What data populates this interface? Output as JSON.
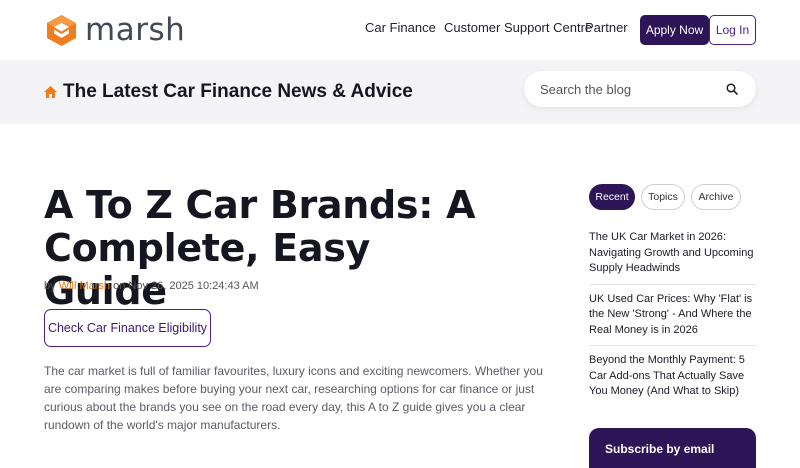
{
  "brand": {
    "name": "marsh",
    "accent": "#f07c1e",
    "primary": "#2d1558"
  },
  "nav": {
    "links": [
      "Car Finance",
      "Customer Support Centre",
      "Partner"
    ],
    "apply_label": "Apply Now",
    "login_label": "Log In"
  },
  "banner": {
    "title": "The Latest Car Finance News & Advice",
    "search_placeholder": "Search the blog",
    "home_icon": "home-icon",
    "search_icon": "search-icon"
  },
  "article": {
    "title": "A To Z Car Brands: A Complete, Easy Guide",
    "byline_prefix": "by",
    "author": "Will Marsh",
    "date_prefix": "on",
    "date": "Nov 26, 2025 10:24:43 AM",
    "cta_label": "Check Car Finance Eligibility",
    "intro": "The car market is full of familiar favourites, luxury icons and exciting newcomers. Whether you are comparing makes before buying your next car, researching options for car finance or just curious about the brands you see on the road every day, this A to Z guide gives you a clear rundown of the world's major manufacturers."
  },
  "sidebar": {
    "tabs": [
      "Recent",
      "Topics",
      "Archive"
    ],
    "active_tab": "Recent",
    "posts": [
      "The UK Car Market in 2026: Navigating Growth and Upcoming Supply Headwinds",
      "UK Used Car Prices: Why 'Flat' is the New 'Strong' - And Where the Real Money is in 2026",
      "Beyond the Monthly Payment: 5 Car Add-ons That Actually Save You Money (And What to Skip)"
    ],
    "subscribe_label": "Subscribe by email"
  }
}
